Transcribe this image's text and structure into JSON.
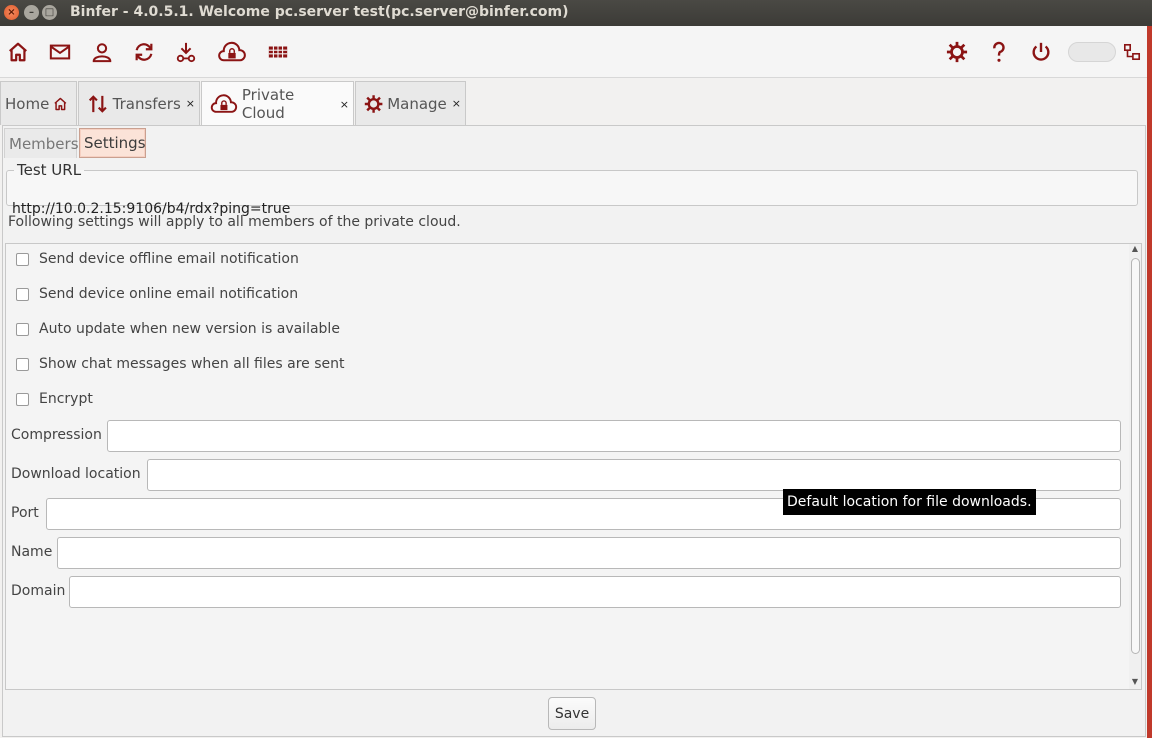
{
  "window": {
    "title": "Binfer - 4.0.5.1. Welcome pc.server test(pc.server@binfer.com)"
  },
  "toolbar": {
    "icons": [
      "home-icon",
      "mail-icon",
      "user-icon",
      "refresh-icon",
      "download-icon",
      "cloud-lock-icon",
      "grid-icon",
      "gear-icon",
      "help-icon",
      "power-icon",
      "network-icon"
    ],
    "accent": "#8b1414"
  },
  "tabs": [
    {
      "label": "Home",
      "icon": "home-icon",
      "closable": false
    },
    {
      "label": "Transfers",
      "icon": "transfers-icon",
      "closable": true
    },
    {
      "label": "Private Cloud",
      "icon": "cloud-lock-icon",
      "closable": true,
      "active": true
    },
    {
      "label": "Manage",
      "icon": "gear-icon",
      "closable": true
    }
  ],
  "close_glyph": "×",
  "subtabs": [
    {
      "label": "Members"
    },
    {
      "label": "Settings",
      "active": true
    }
  ],
  "test_url": {
    "legend": "Test URL",
    "value": "http://10.0.2.15:9106/b4/rdx?ping=true"
  },
  "info_text": "Following settings will apply to all members of the private cloud.",
  "checkboxes": [
    {
      "label": "Send device offline email notification",
      "checked": false
    },
    {
      "label": "Send device online email notification",
      "checked": false
    },
    {
      "label": "Auto update when new version is available",
      "checked": false
    },
    {
      "label": "Show chat messages when all files are sent",
      "checked": false
    },
    {
      "label": "Encrypt",
      "checked": false
    }
  ],
  "fields": [
    {
      "label": "Compression",
      "value": ""
    },
    {
      "label": "Download location",
      "value": ""
    },
    {
      "label": "Port",
      "value": ""
    },
    {
      "label": "Name",
      "value": ""
    },
    {
      "label": "Domain",
      "value": ""
    }
  ],
  "tooltip": "Default location for file downloads.",
  "save_label": "Save"
}
